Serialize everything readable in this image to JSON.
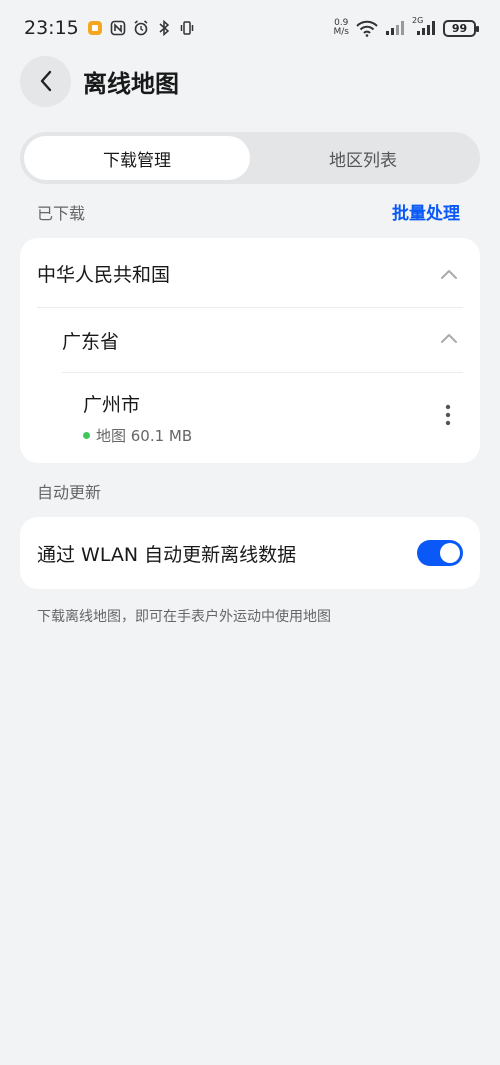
{
  "status_bar": {
    "time": "23:15",
    "net_speed_value": "0.9",
    "net_speed_unit": "M/s",
    "signal_label": "2G",
    "battery": "99",
    "icons": [
      "app-notification-icon",
      "nfc-icon",
      "alarm-icon",
      "bluetooth-icon",
      "vibrate-icon",
      "wifi-icon",
      "signal-icon",
      "signal-2g-icon"
    ]
  },
  "header": {
    "title": "离线地图"
  },
  "tabs": [
    {
      "label": "下载管理",
      "active": true
    },
    {
      "label": "地区列表",
      "active": false
    }
  ],
  "downloaded": {
    "section_label": "已下载",
    "batch_action": "批量处理",
    "country": "中华人民共和国",
    "province": "广东省",
    "city": "广州市",
    "city_detail": "地图 60.1 MB"
  },
  "auto_update": {
    "section_label": "自动更新",
    "toggle_label": "通过 WLAN 自动更新离线数据",
    "enabled": true
  },
  "footnote": "下载离线地图，即可在手表户外运动中使用地图",
  "colors": {
    "accent": "#0a59f7",
    "background": "#f1f3f5",
    "status_dot": "#3ec75b"
  }
}
